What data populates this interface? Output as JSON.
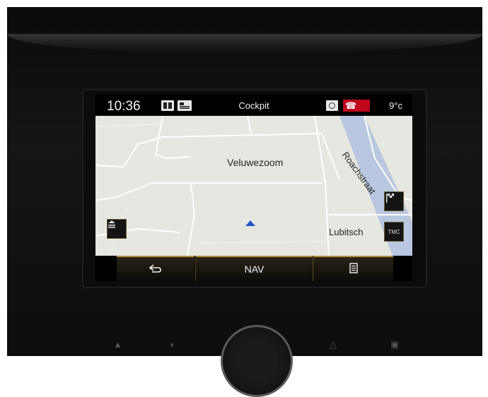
{
  "status_bar": {
    "time": "10:36",
    "title": "Cockpit",
    "temperature": "9°c",
    "icons": [
      "book-icon",
      "media-icon",
      "notification-icon",
      "phone-icon"
    ]
  },
  "map": {
    "area_label": "Veluwezoom",
    "street_1": "Roachstraat",
    "street_2": "Lubitsch",
    "position_marker": "current-position-arrow",
    "side_buttons": {
      "left": "layers-icon",
      "right_top": "checkered-flag-icon",
      "right_bottom_label": "TMC"
    }
  },
  "bottom_bar": {
    "back_icon": "back-arrow-icon",
    "nav_label": "NAV",
    "menu_icon": "list-icon"
  },
  "colors": {
    "accent": "#b3903c",
    "map_background": "#e7e7e1",
    "water": "#b9c8e0",
    "phone_indicator": "#c0081c"
  }
}
